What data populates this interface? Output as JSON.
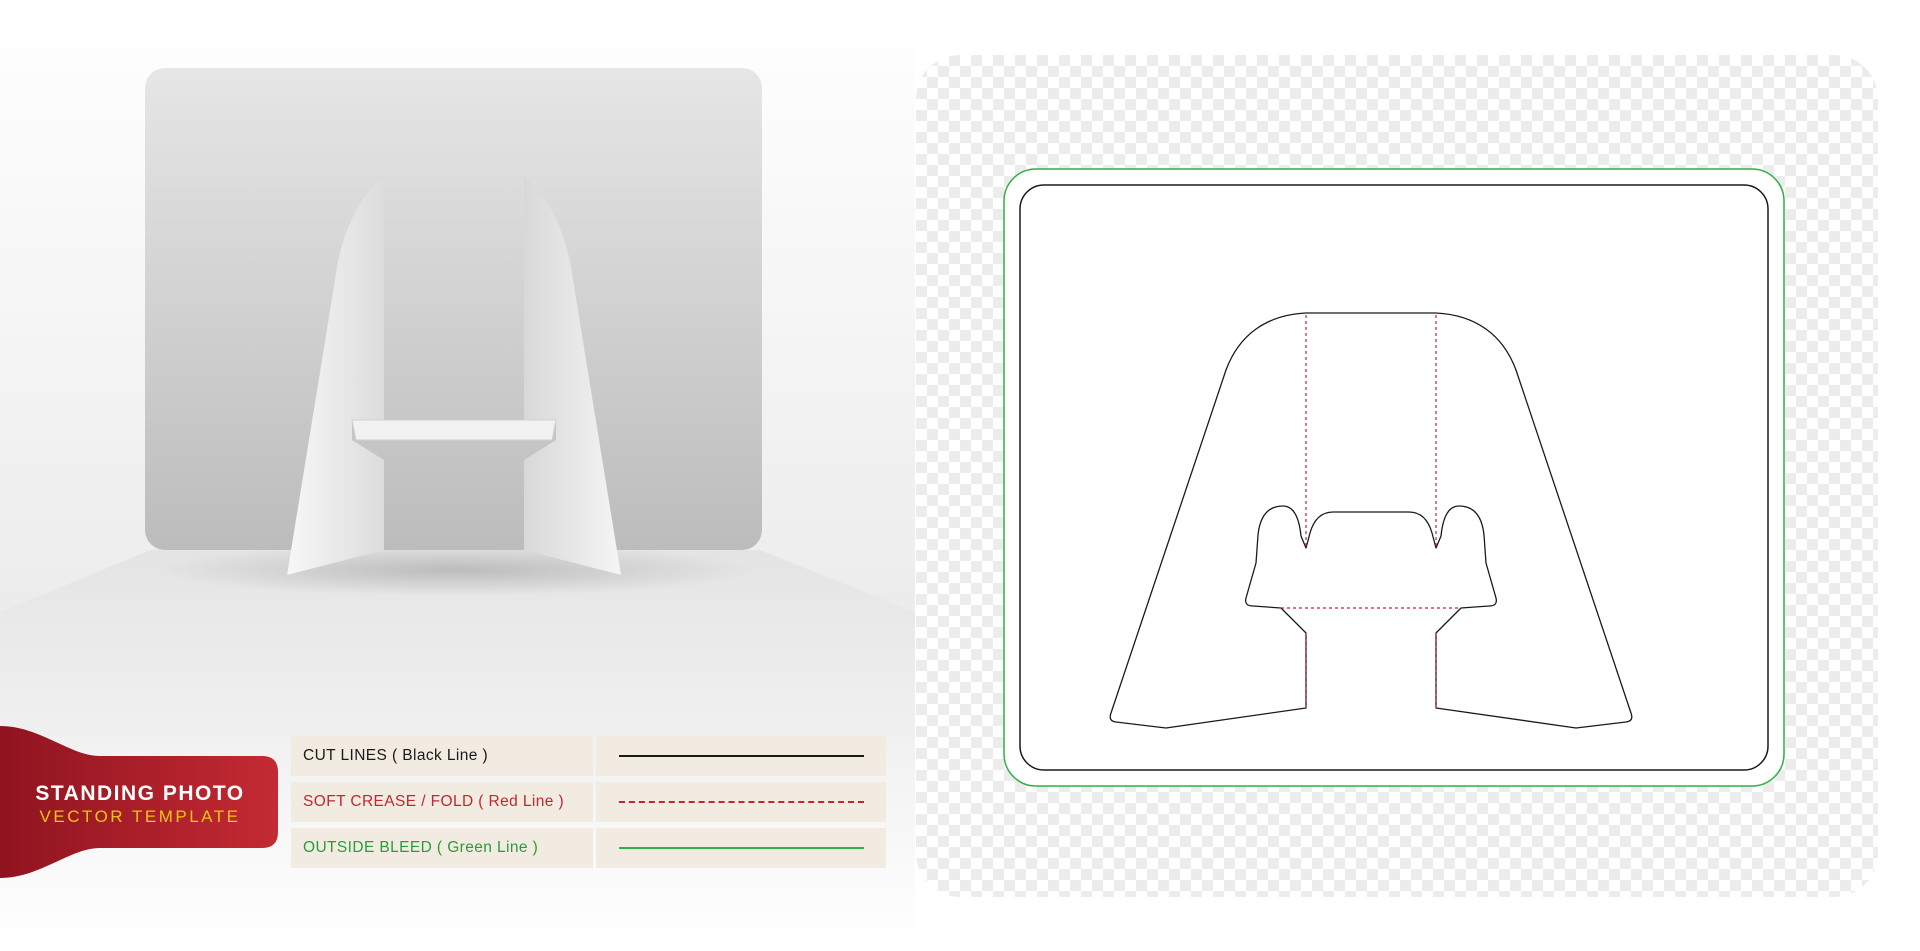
{
  "badge": {
    "title": "STANDING PHOTO",
    "subtitle": "VECTOR TEMPLATE"
  },
  "legend": {
    "items": [
      {
        "label": "CUT LINES ( Black Line )",
        "color": "#1a1a1a",
        "style": "solid"
      },
      {
        "label": "SOFT CREASE / FOLD ( Red Line )",
        "color": "#c0282d",
        "style": "dashed"
      },
      {
        "label": "OUTSIDE BLEED ( Green Line )",
        "color": "#2fb046",
        "style": "solid"
      }
    ]
  },
  "colors": {
    "cut_line": "#1a1a1a",
    "crease_line": "#c0282d",
    "bleed_line": "#2fb046",
    "badge": "#b3202c",
    "legend_background": "#f2ebe1"
  }
}
